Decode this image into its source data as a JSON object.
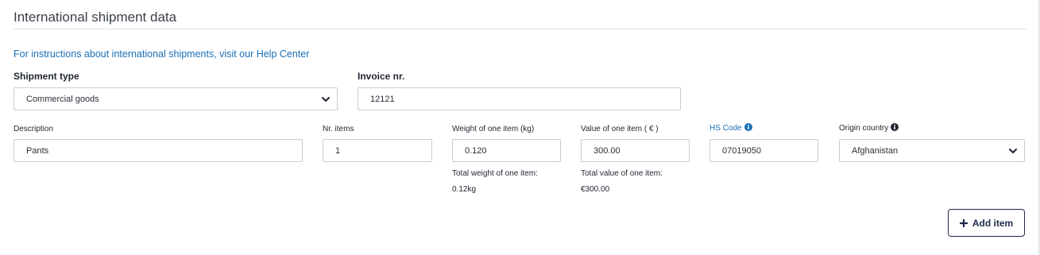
{
  "section": {
    "title": "International shipment data",
    "help_link": "For instructions about international shipments, visit our Help Center"
  },
  "shipment_type": {
    "label": "Shipment type",
    "value": "Commercial goods"
  },
  "invoice": {
    "label": "Invoice nr.",
    "value": "12121"
  },
  "item": {
    "description": {
      "label": "Description",
      "value": "Pants"
    },
    "nr_items": {
      "label": "Nr. items",
      "value": "1"
    },
    "weight": {
      "label": "Weight of one item (kg)",
      "value": "0.120"
    },
    "value": {
      "label": "Value of one item ( € )",
      "value": "300.00"
    },
    "hs_code": {
      "label": "HS Code",
      "value": "07019050"
    },
    "origin_country": {
      "label": "Origin country",
      "value": "Afghanistan"
    },
    "total_weight": {
      "label": "Total weight of one item:",
      "value": "0.12kg"
    },
    "total_value": {
      "label": "Total value of one item:",
      "value": "€300.00"
    }
  },
  "buttons": {
    "add_item": "Add item"
  },
  "icons": {
    "info": "info-circle-icon",
    "chevron": "chevron-down-icon",
    "plus": "plus-icon"
  },
  "colors": {
    "link": "#1b6fb6",
    "button_border": "#1e2a4a",
    "input_border": "#c9cdd3"
  }
}
